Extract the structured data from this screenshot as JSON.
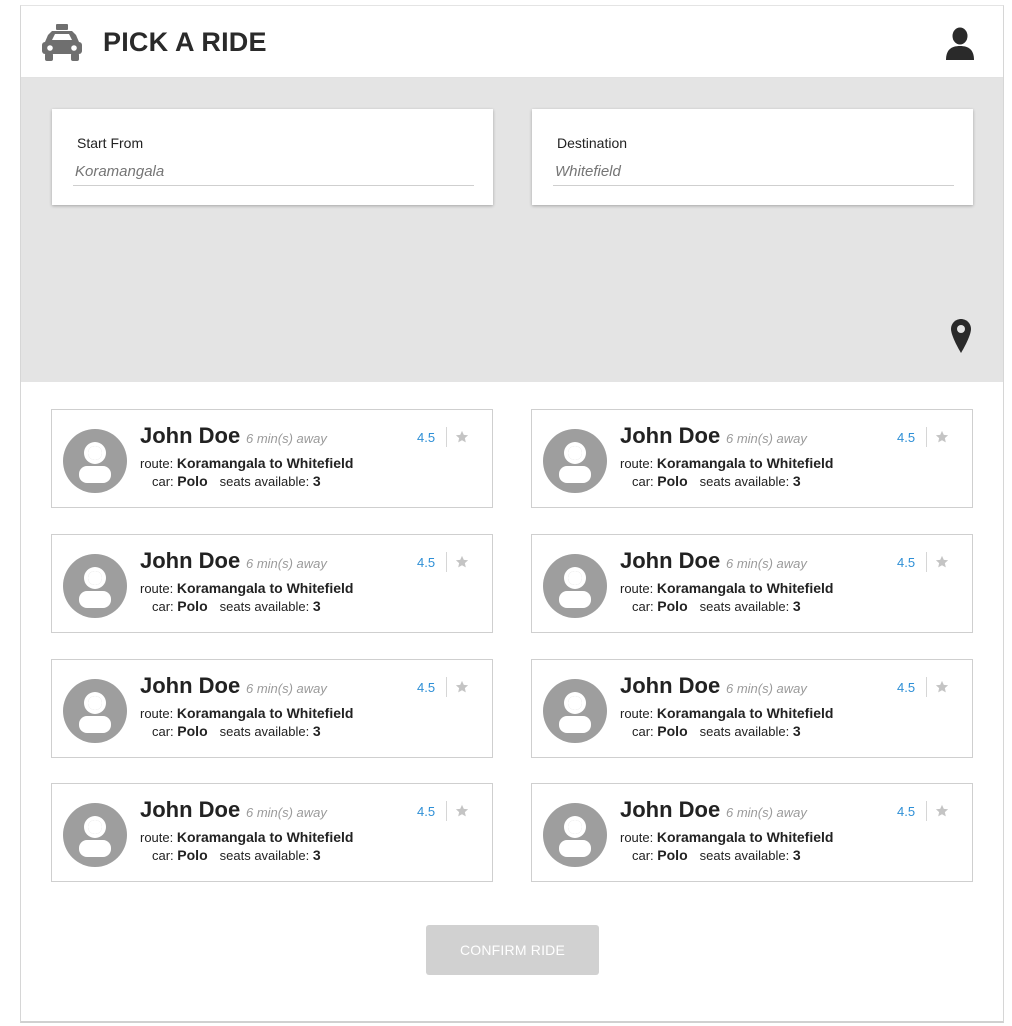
{
  "header": {
    "title": "PICK A RIDE",
    "logo_icon": "taxi-icon",
    "profile_icon": "user-icon"
  },
  "search": {
    "start": {
      "label": "Start From",
      "placeholder": "Koramangala"
    },
    "destination": {
      "label": "Destination",
      "placeholder": "Whitefield"
    },
    "location_icon": "map-pin-icon"
  },
  "rides": [
    {
      "name": "John Doe",
      "eta": "6 min(s) away",
      "rating": "4.5",
      "route_label": "route:",
      "route": "Koramangala to Whitefield",
      "car_label": "car:",
      "car": "Polo",
      "seats_label": "seats available:",
      "seats": "3"
    },
    {
      "name": "John Doe",
      "eta": "6 min(s) away",
      "rating": "4.5",
      "route_label": "route:",
      "route": "Koramangala to Whitefield",
      "car_label": "car:",
      "car": "Polo",
      "seats_label": "seats available:",
      "seats": "3"
    },
    {
      "name": "John Doe",
      "eta": "6 min(s) away",
      "rating": "4.5",
      "route_label": "route:",
      "route": "Koramangala to Whitefield",
      "car_label": "car:",
      "car": "Polo",
      "seats_label": "seats available:",
      "seats": "3"
    },
    {
      "name": "John Doe",
      "eta": "6 min(s) away",
      "rating": "4.5",
      "route_label": "route:",
      "route": "Koramangala to Whitefield",
      "car_label": "car:",
      "car": "Polo",
      "seats_label": "seats available:",
      "seats": "3"
    },
    {
      "name": "John Doe",
      "eta": "6 min(s) away",
      "rating": "4.5",
      "route_label": "route:",
      "route": "Koramangala to Whitefield",
      "car_label": "car:",
      "car": "Polo",
      "seats_label": "seats available:",
      "seats": "3"
    },
    {
      "name": "John Doe",
      "eta": "6 min(s) away",
      "rating": "4.5",
      "route_label": "route:",
      "route": "Koramangala to Whitefield",
      "car_label": "car:",
      "car": "Polo",
      "seats_label": "seats available:",
      "seats": "3"
    },
    {
      "name": "John Doe",
      "eta": "6 min(s) away",
      "rating": "4.5",
      "route_label": "route:",
      "route": "Koramangala to Whitefield",
      "car_label": "car:",
      "car": "Polo",
      "seats_label": "seats available:",
      "seats": "3"
    },
    {
      "name": "John Doe",
      "eta": "6 min(s) away",
      "rating": "4.5",
      "route_label": "route:",
      "route": "Koramangala to Whitefield",
      "car_label": "car:",
      "car": "Polo",
      "seats_label": "seats available:",
      "seats": "3"
    }
  ],
  "confirm": {
    "label": "CONFIRM RIDE"
  },
  "colors": {
    "rating": "#2e8fd6",
    "map_background": "#e4e4e4",
    "button_disabled": "#d1d1d1",
    "avatar": "#9e9e9e"
  }
}
